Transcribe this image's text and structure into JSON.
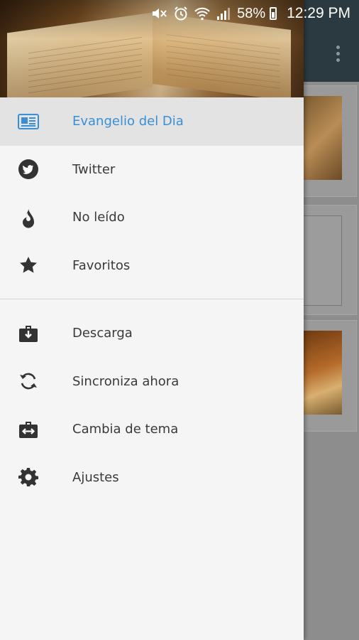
{
  "status_bar": {
    "battery_percent": "58%",
    "time": "12:29 PM",
    "icons": [
      "mute-icon",
      "alarm-icon",
      "wifi-icon",
      "signal-icon",
      "battery-icon"
    ]
  },
  "drawer": {
    "primary_items": [
      {
        "label": "Evangelio del Dia",
        "icon": "news-icon",
        "active": true
      },
      {
        "label": "Twitter",
        "icon": "twitter-icon",
        "active": false
      },
      {
        "label": "No leído",
        "icon": "flame-icon",
        "active": false
      },
      {
        "label": "Favoritos",
        "icon": "star-icon",
        "active": false
      }
    ],
    "secondary_items": [
      {
        "label": "Descarga",
        "icon": "download-case-icon"
      },
      {
        "label": "Sincroniza ahora",
        "icon": "sync-icon"
      },
      {
        "label": "Cambia de tema",
        "icon": "swap-case-icon"
      },
      {
        "label": "Ajustes",
        "icon": "gear-icon"
      }
    ]
  },
  "colors": {
    "accent": "#3a8fd4",
    "drawer_bg": "#f5f5f5",
    "active_bg": "#e3e3e3",
    "toolbar": "#2b3a40"
  }
}
